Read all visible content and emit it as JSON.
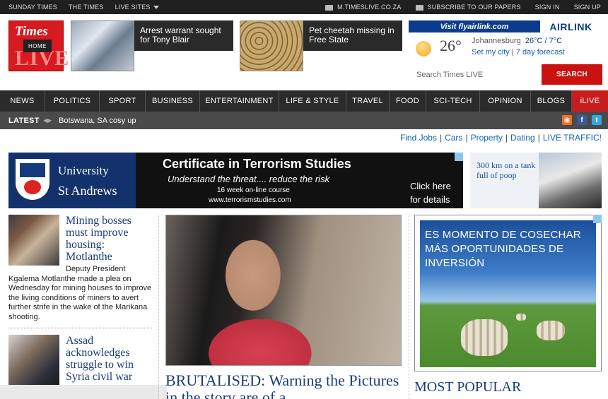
{
  "topbar": {
    "left": [
      "SUNDAY TIMES",
      "THE TIMES",
      "LIVE SITES"
    ],
    "mobile": "M.TIMESLIVE.CO.ZA",
    "subscribe": "SUBSCRIBE TO OUR PAPERS",
    "signin": "SIGN IN",
    "signup": "SIGN UP"
  },
  "logo": {
    "line1": "Times",
    "line2": "LIVE",
    "home": "HOME"
  },
  "teasers": [
    {
      "text": "Arrest warrant sought for Tony Blair",
      "icon": "photo-tony-blair"
    },
    {
      "text": "Pet cheetah missing in Free State",
      "icon": "photo-cheetah"
    }
  ],
  "airlink": {
    "url": "Visit flyairlink.com",
    "brand": "AIRLINK"
  },
  "weather": {
    "temp": "26°",
    "city": "Johannesburg",
    "range": "26°C / 7°C",
    "set_city": "Set my city",
    "forecast": "7 day forecast"
  },
  "search": {
    "placeholder": "Search Times LIVE",
    "button": "SEARCH"
  },
  "nav": [
    "NEWS",
    "POLITICS",
    "SPORT",
    "BUSINESS",
    "ENTERTAINMENT",
    "LIFE & STYLE",
    "TRAVEL",
    "FOOD",
    "SCI-TECH",
    "OPINION",
    "BLOGS",
    "iLIVE"
  ],
  "latest": {
    "label": "LATEST",
    "headline": "Botswana, SA cosy up"
  },
  "links": [
    "Find Jobs",
    "Cars",
    "Property",
    "Dating",
    "LIVE TRAFFIC!"
  ],
  "banner_ad": {
    "uni_line1": "University",
    "uni_line2": "St Andrews",
    "title": "Certificate in Terrorism Studies",
    "subtitle": "Understand the threat.... reduce the risk",
    "course": "16 week on-line course",
    "url": "www.terrorismstudies.com",
    "cta_line1": "Click here",
    "cta_line2": "for details"
  },
  "side_ad": {
    "text": "300 km on a tank full of poop"
  },
  "stories": [
    {
      "headline": "Mining bosses must improve housing: Motlanthe",
      "body": "Deputy President Kgalema Motlanthe made a plea on Wednesday for mining houses to improve the living conditions of miners to avert further strife in the wake of the Marikana shooting."
    },
    {
      "headline": "Assad acknowledges struggle to win Syria civil war",
      "body": ""
    }
  ],
  "main": {
    "headline": "BRUTALISED: Warning the Pictures in the story are of a"
  },
  "right_ad": {
    "text": "ES MOMENTO DE COSECHAR MÁS OPORTUNIDADES DE INVERSIÓN"
  },
  "most_popular": "MOST POPULAR",
  "colors": {
    "brand_red": "#d71920",
    "nav_bg": "#2b2b2b",
    "link_blue": "#1463b5",
    "headline_blue": "#1a3c7a"
  }
}
